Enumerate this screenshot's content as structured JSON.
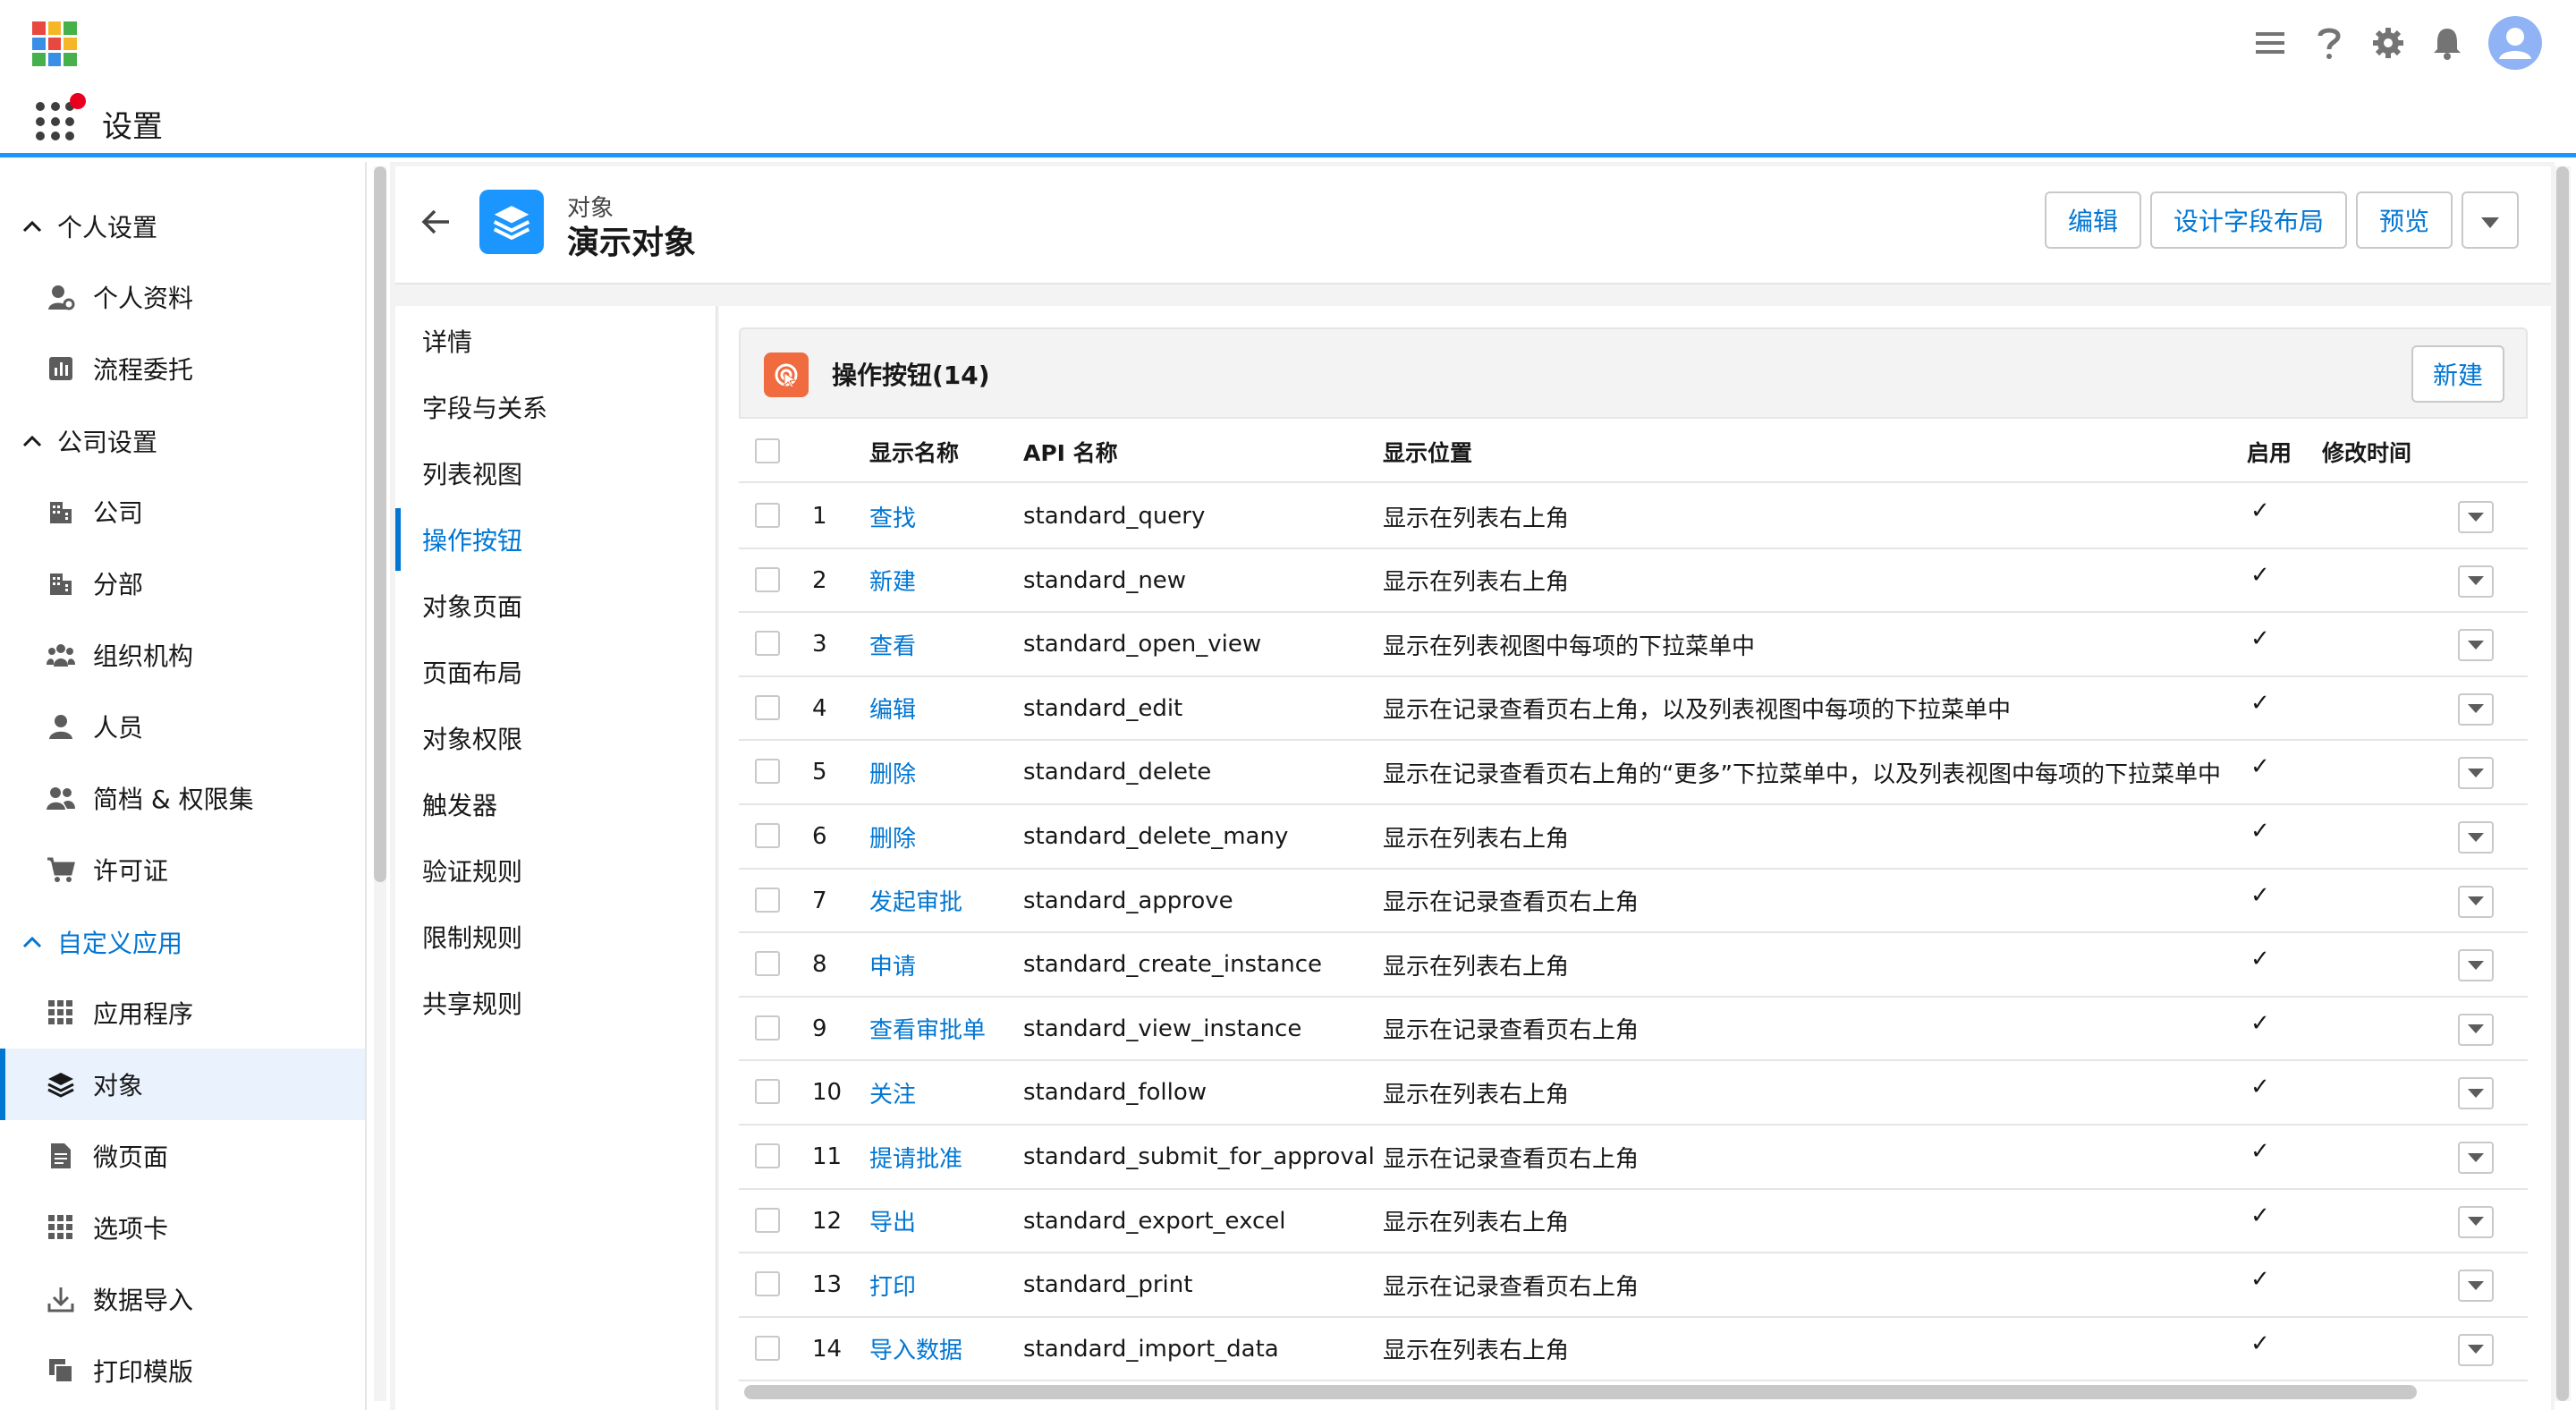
{
  "app": {
    "name": "设置"
  },
  "sidebar": {
    "groups": [
      {
        "label": "个人设置",
        "items": [
          "个人资料",
          "流程委托"
        ]
      },
      {
        "label": "公司设置",
        "items": [
          "公司",
          "分部",
          "组织机构",
          "人员",
          "简档 & 权限集",
          "许可证"
        ]
      },
      {
        "label": "自定义应用",
        "items": [
          "应用程序",
          "对象",
          "微页面",
          "选项卡",
          "数据导入",
          "打印模版"
        ]
      }
    ],
    "active_item": "对象"
  },
  "object": {
    "type_label": "对象",
    "name": "演示对象",
    "buttons": {
      "edit": "编辑",
      "design_layout": "设计字段布局",
      "preview": "预览"
    }
  },
  "tabs": [
    "详情",
    "字段与关系",
    "列表视图",
    "操作按钮",
    "对象页面",
    "页面布局",
    "对象权限",
    "触发器",
    "验证规则",
    "限制规则",
    "共享规则"
  ],
  "active_tab": "操作按钮",
  "list": {
    "title": "操作按钮(14)",
    "new_label": "新建",
    "columns": {
      "name": "显示名称",
      "api": "API 名称",
      "position": "显示位置",
      "enabled": "启用",
      "modified": "修改时间"
    },
    "rows": [
      {
        "num": "1",
        "name": "查找",
        "api": "standard_query",
        "position": "显示在列表右上角",
        "enabled": "✓"
      },
      {
        "num": "2",
        "name": "新建",
        "api": "standard_new",
        "position": "显示在列表右上角",
        "enabled": "✓"
      },
      {
        "num": "3",
        "name": "查看",
        "api": "standard_open_view",
        "position": "显示在列表视图中每项的下拉菜单中",
        "enabled": "✓"
      },
      {
        "num": "4",
        "name": "编辑",
        "api": "standard_edit",
        "position": "显示在记录查看页右上角，以及列表视图中每项的下拉菜单中",
        "enabled": "✓"
      },
      {
        "num": "5",
        "name": "删除",
        "api": "standard_delete",
        "position": "显示在记录查看页右上角的“更多”下拉菜单中，以及列表视图中每项的下拉菜单中",
        "enabled": "✓"
      },
      {
        "num": "6",
        "name": "删除",
        "api": "standard_delete_many",
        "position": "显示在列表右上角",
        "enabled": "✓"
      },
      {
        "num": "7",
        "name": "发起审批",
        "api": "standard_approve",
        "position": "显示在记录查看页右上角",
        "enabled": "✓"
      },
      {
        "num": "8",
        "name": "申请",
        "api": "standard_create_instance",
        "position": "显示在列表右上角",
        "enabled": "✓"
      },
      {
        "num": "9",
        "name": "查看审批单",
        "api": "standard_view_instance",
        "position": "显示在记录查看页右上角",
        "enabled": "✓"
      },
      {
        "num": "10",
        "name": "关注",
        "api": "standard_follow",
        "position": "显示在列表右上角",
        "enabled": "✓"
      },
      {
        "num": "11",
        "name": "提请批准",
        "api": "standard_submit_for_approval",
        "position": "显示在记录查看页右上角",
        "enabled": "✓"
      },
      {
        "num": "12",
        "name": "导出",
        "api": "standard_export_excel",
        "position": "显示在列表右上角",
        "enabled": "✓"
      },
      {
        "num": "13",
        "name": "打印",
        "api": "standard_print",
        "position": "显示在记录查看页右上角",
        "enabled": "✓"
      },
      {
        "num": "14",
        "name": "导入数据",
        "api": "standard_import_data",
        "position": "显示在列表右上角",
        "enabled": "✓"
      }
    ]
  },
  "colors": {
    "accent": "#0176d3",
    "brand_blue": "#1b96ff",
    "list_icon": "#f06b3f",
    "avatar": "#8fb3f5"
  }
}
